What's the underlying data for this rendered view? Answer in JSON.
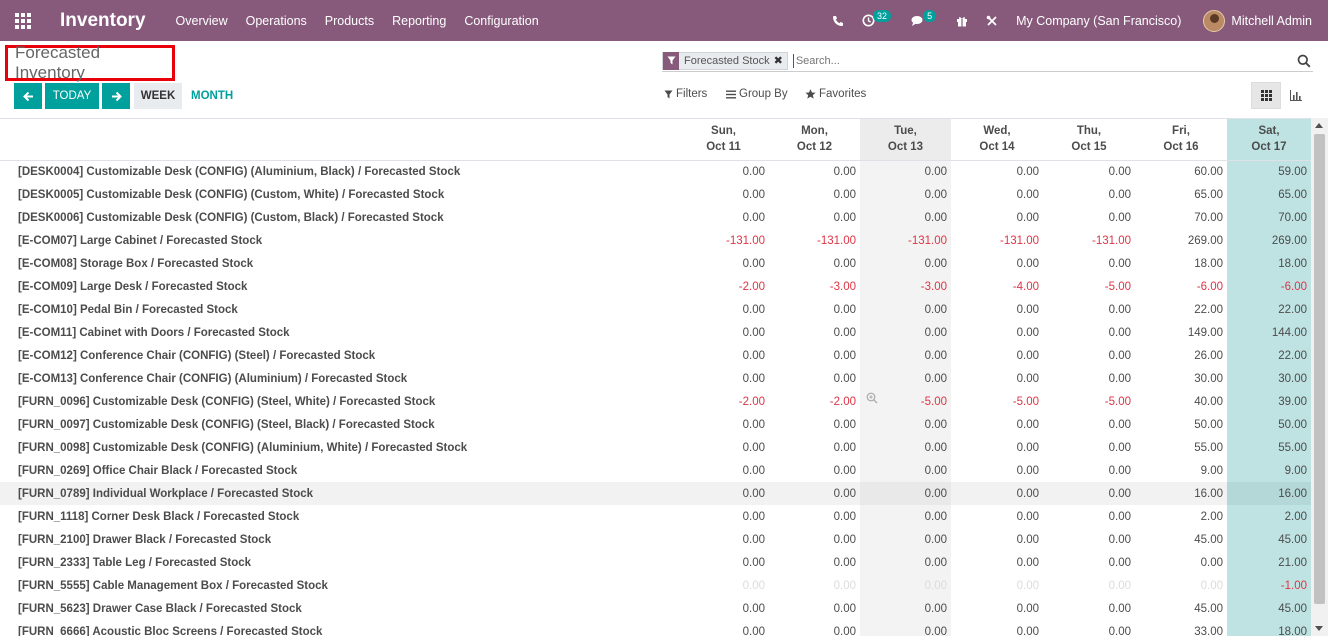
{
  "navbar": {
    "app_title": "Inventory",
    "menu": [
      "Overview",
      "Operations",
      "Products",
      "Reporting",
      "Configuration"
    ],
    "activity_count": "32",
    "message_count": "5",
    "company": "My Company (San Francisco)",
    "user": "Mitchell Admin",
    "bg_color": "#875a7b"
  },
  "control": {
    "page_title": "Forecasted Inventory",
    "today_label": "TODAY",
    "week_label": "WEEK",
    "month_label": "MONTH",
    "facet_label": "Forecasted Stock",
    "search_placeholder": "Search...",
    "filters_label": "Filters",
    "groupby_label": "Group By",
    "favorites_label": "Favorites"
  },
  "columns": [
    {
      "day": "Sun,",
      "date": "Oct 11"
    },
    {
      "day": "Mon,",
      "date": "Oct 12"
    },
    {
      "day": "Tue,",
      "date": "Oct 13"
    },
    {
      "day": "Wed,",
      "date": "Oct 14"
    },
    {
      "day": "Thu,",
      "date": "Oct 15"
    },
    {
      "day": "Fri,",
      "date": "Oct 16"
    },
    {
      "day": "Sat,",
      "date": "Oct 17"
    }
  ],
  "rows": [
    {
      "label": "[DESK0004] Customizable Desk (CONFIG) (Aluminium, Black) / Forecasted Stock",
      "values": [
        "0.00",
        "0.00",
        "0.00",
        "0.00",
        "0.00",
        "60.00",
        "59.00"
      ]
    },
    {
      "label": "[DESK0005] Customizable Desk (CONFIG) (Custom, White) / Forecasted Stock",
      "values": [
        "0.00",
        "0.00",
        "0.00",
        "0.00",
        "0.00",
        "65.00",
        "65.00"
      ]
    },
    {
      "label": "[DESK0006] Customizable Desk (CONFIG) (Custom, Black) / Forecasted Stock",
      "values": [
        "0.00",
        "0.00",
        "0.00",
        "0.00",
        "0.00",
        "70.00",
        "70.00"
      ]
    },
    {
      "label": "[E-COM07] Large Cabinet  / Forecasted Stock",
      "values": [
        "-131.00",
        "-131.00",
        "-131.00",
        "-131.00",
        "-131.00",
        "269.00",
        "269.00"
      ]
    },
    {
      "label": "[E-COM08] Storage Box  / Forecasted Stock",
      "values": [
        "0.00",
        "0.00",
        "0.00",
        "0.00",
        "0.00",
        "18.00",
        "18.00"
      ]
    },
    {
      "label": "[E-COM09] Large Desk  / Forecasted Stock",
      "values": [
        "-2.00",
        "-3.00",
        "-3.00",
        "-4.00",
        "-5.00",
        "-6.00",
        "-6.00"
      ]
    },
    {
      "label": "[E-COM10] Pedal Bin  / Forecasted Stock",
      "values": [
        "0.00",
        "0.00",
        "0.00",
        "0.00",
        "0.00",
        "22.00",
        "22.00"
      ]
    },
    {
      "label": "[E-COM11] Cabinet with Doors  / Forecasted Stock",
      "values": [
        "0.00",
        "0.00",
        "0.00",
        "0.00",
        "0.00",
        "149.00",
        "144.00"
      ]
    },
    {
      "label": "[E-COM12] Conference Chair (CONFIG) (Steel)  / Forecasted Stock",
      "values": [
        "0.00",
        "0.00",
        "0.00",
        "0.00",
        "0.00",
        "26.00",
        "22.00"
      ]
    },
    {
      "label": "[E-COM13] Conference Chair (CONFIG) (Aluminium)  / Forecasted Stock",
      "values": [
        "0.00",
        "0.00",
        "0.00",
        "0.00",
        "0.00",
        "30.00",
        "30.00"
      ]
    },
    {
      "label": "[FURN_0096] Customizable Desk (CONFIG) (Steel, White)  / Forecasted Stock",
      "values": [
        "-2.00",
        "-2.00",
        "-5.00",
        "-5.00",
        "-5.00",
        "40.00",
        "39.00"
      ]
    },
    {
      "label": "[FURN_0097] Customizable Desk (CONFIG) (Steel, Black)  / Forecasted Stock",
      "values": [
        "0.00",
        "0.00",
        "0.00",
        "0.00",
        "0.00",
        "50.00",
        "50.00"
      ]
    },
    {
      "label": "[FURN_0098] Customizable Desk (CONFIG) (Aluminium, White)  / Forecasted Stock",
      "values": [
        "0.00",
        "0.00",
        "0.00",
        "0.00",
        "0.00",
        "55.00",
        "55.00"
      ]
    },
    {
      "label": "[FURN_0269] Office Chair Black  / Forecasted Stock",
      "values": [
        "0.00",
        "0.00",
        "0.00",
        "0.00",
        "0.00",
        "9.00",
        "9.00"
      ]
    },
    {
      "label": "[FURN_0789] Individual Workplace  / Forecasted Stock",
      "values": [
        "0.00",
        "0.00",
        "0.00",
        "0.00",
        "0.00",
        "16.00",
        "16.00"
      ]
    },
    {
      "label": "[FURN_1118] Corner Desk Black  / Forecasted Stock",
      "values": [
        "0.00",
        "0.00",
        "0.00",
        "0.00",
        "0.00",
        "2.00",
        "2.00"
      ]
    },
    {
      "label": "[FURN_2100] Drawer Black  / Forecasted Stock",
      "values": [
        "0.00",
        "0.00",
        "0.00",
        "0.00",
        "0.00",
        "45.00",
        "45.00"
      ]
    },
    {
      "label": "[FURN_2333] Table Leg  / Forecasted Stock",
      "values": [
        "0.00",
        "0.00",
        "0.00",
        "0.00",
        "0.00",
        "0.00",
        "21.00"
      ]
    },
    {
      "label": "[FURN_5555] Cable Management Box  / Forecasted Stock",
      "values": [
        "0.00",
        "0.00",
        "0.00",
        "0.00",
        "0.00",
        "0.00",
        "-1.00"
      ],
      "faint": true
    },
    {
      "label": "[FURN_5623] Drawer Case Black  / Forecasted Stock",
      "values": [
        "0.00",
        "0.00",
        "0.00",
        "0.00",
        "0.00",
        "45.00",
        "45.00"
      ]
    },
    {
      "label": "[FURN_6666] Acoustic Bloc Screens  / Forecasted Stock",
      "values": [
        "0.00",
        "0.00",
        "0.00",
        "0.00",
        "0.00",
        "33.00",
        "18.00"
      ]
    }
  ]
}
